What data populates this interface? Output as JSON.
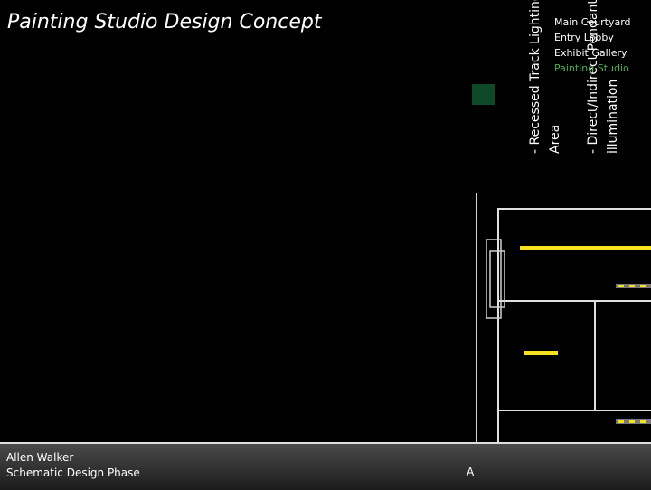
{
  "title": "Painting Studio Design Concept",
  "vertical_labels": {
    "track_light": "- Recessed Track Lighting",
    "area": "Area",
    "direct_indirect": "- Direct/Indirect Pendant",
    "illumination": "illumination"
  },
  "nav": {
    "items": [
      "Main Courtyard",
      "Entry Lobby",
      "Exhibit Gallery",
      "Painting Studio"
    ],
    "active": "Painting Studio"
  },
  "footer": {
    "author": "Allen Walker",
    "phase": "Schematic Design Phase",
    "abbr": "A"
  },
  "colors": {
    "background": "#000000",
    "accent_green": "#4caf50",
    "swatch": "#0e4a28",
    "light_bar": "#f5e11d"
  }
}
